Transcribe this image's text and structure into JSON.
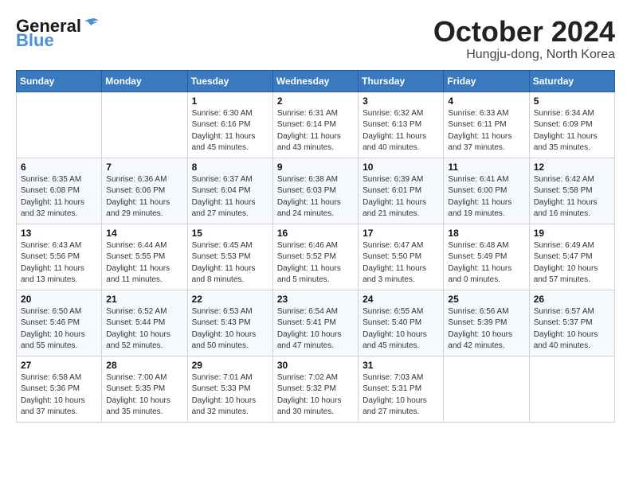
{
  "header": {
    "logo_general": "General",
    "logo_blue": "Blue",
    "month_year": "October 2024",
    "location": "Hungju-dong, North Korea"
  },
  "weekdays": [
    "Sunday",
    "Monday",
    "Tuesday",
    "Wednesday",
    "Thursday",
    "Friday",
    "Saturday"
  ],
  "weeks": [
    [
      {
        "day": "",
        "detail": ""
      },
      {
        "day": "",
        "detail": ""
      },
      {
        "day": "1",
        "detail": "Sunrise: 6:30 AM\nSunset: 6:16 PM\nDaylight: 11 hours and 45 minutes."
      },
      {
        "day": "2",
        "detail": "Sunrise: 6:31 AM\nSunset: 6:14 PM\nDaylight: 11 hours and 43 minutes."
      },
      {
        "day": "3",
        "detail": "Sunrise: 6:32 AM\nSunset: 6:13 PM\nDaylight: 11 hours and 40 minutes."
      },
      {
        "day": "4",
        "detail": "Sunrise: 6:33 AM\nSunset: 6:11 PM\nDaylight: 11 hours and 37 minutes."
      },
      {
        "day": "5",
        "detail": "Sunrise: 6:34 AM\nSunset: 6:09 PM\nDaylight: 11 hours and 35 minutes."
      }
    ],
    [
      {
        "day": "6",
        "detail": "Sunrise: 6:35 AM\nSunset: 6:08 PM\nDaylight: 11 hours and 32 minutes."
      },
      {
        "day": "7",
        "detail": "Sunrise: 6:36 AM\nSunset: 6:06 PM\nDaylight: 11 hours and 29 minutes."
      },
      {
        "day": "8",
        "detail": "Sunrise: 6:37 AM\nSunset: 6:04 PM\nDaylight: 11 hours and 27 minutes."
      },
      {
        "day": "9",
        "detail": "Sunrise: 6:38 AM\nSunset: 6:03 PM\nDaylight: 11 hours and 24 minutes."
      },
      {
        "day": "10",
        "detail": "Sunrise: 6:39 AM\nSunset: 6:01 PM\nDaylight: 11 hours and 21 minutes."
      },
      {
        "day": "11",
        "detail": "Sunrise: 6:41 AM\nSunset: 6:00 PM\nDaylight: 11 hours and 19 minutes."
      },
      {
        "day": "12",
        "detail": "Sunrise: 6:42 AM\nSunset: 5:58 PM\nDaylight: 11 hours and 16 minutes."
      }
    ],
    [
      {
        "day": "13",
        "detail": "Sunrise: 6:43 AM\nSunset: 5:56 PM\nDaylight: 11 hours and 13 minutes."
      },
      {
        "day": "14",
        "detail": "Sunrise: 6:44 AM\nSunset: 5:55 PM\nDaylight: 11 hours and 11 minutes."
      },
      {
        "day": "15",
        "detail": "Sunrise: 6:45 AM\nSunset: 5:53 PM\nDaylight: 11 hours and 8 minutes."
      },
      {
        "day": "16",
        "detail": "Sunrise: 6:46 AM\nSunset: 5:52 PM\nDaylight: 11 hours and 5 minutes."
      },
      {
        "day": "17",
        "detail": "Sunrise: 6:47 AM\nSunset: 5:50 PM\nDaylight: 11 hours and 3 minutes."
      },
      {
        "day": "18",
        "detail": "Sunrise: 6:48 AM\nSunset: 5:49 PM\nDaylight: 11 hours and 0 minutes."
      },
      {
        "day": "19",
        "detail": "Sunrise: 6:49 AM\nSunset: 5:47 PM\nDaylight: 10 hours and 57 minutes."
      }
    ],
    [
      {
        "day": "20",
        "detail": "Sunrise: 6:50 AM\nSunset: 5:46 PM\nDaylight: 10 hours and 55 minutes."
      },
      {
        "day": "21",
        "detail": "Sunrise: 6:52 AM\nSunset: 5:44 PM\nDaylight: 10 hours and 52 minutes."
      },
      {
        "day": "22",
        "detail": "Sunrise: 6:53 AM\nSunset: 5:43 PM\nDaylight: 10 hours and 50 minutes."
      },
      {
        "day": "23",
        "detail": "Sunrise: 6:54 AM\nSunset: 5:41 PM\nDaylight: 10 hours and 47 minutes."
      },
      {
        "day": "24",
        "detail": "Sunrise: 6:55 AM\nSunset: 5:40 PM\nDaylight: 10 hours and 45 minutes."
      },
      {
        "day": "25",
        "detail": "Sunrise: 6:56 AM\nSunset: 5:39 PM\nDaylight: 10 hours and 42 minutes."
      },
      {
        "day": "26",
        "detail": "Sunrise: 6:57 AM\nSunset: 5:37 PM\nDaylight: 10 hours and 40 minutes."
      }
    ],
    [
      {
        "day": "27",
        "detail": "Sunrise: 6:58 AM\nSunset: 5:36 PM\nDaylight: 10 hours and 37 minutes."
      },
      {
        "day": "28",
        "detail": "Sunrise: 7:00 AM\nSunset: 5:35 PM\nDaylight: 10 hours and 35 minutes."
      },
      {
        "day": "29",
        "detail": "Sunrise: 7:01 AM\nSunset: 5:33 PM\nDaylight: 10 hours and 32 minutes."
      },
      {
        "day": "30",
        "detail": "Sunrise: 7:02 AM\nSunset: 5:32 PM\nDaylight: 10 hours and 30 minutes."
      },
      {
        "day": "31",
        "detail": "Sunrise: 7:03 AM\nSunset: 5:31 PM\nDaylight: 10 hours and 27 minutes."
      },
      {
        "day": "",
        "detail": ""
      },
      {
        "day": "",
        "detail": ""
      }
    ]
  ]
}
